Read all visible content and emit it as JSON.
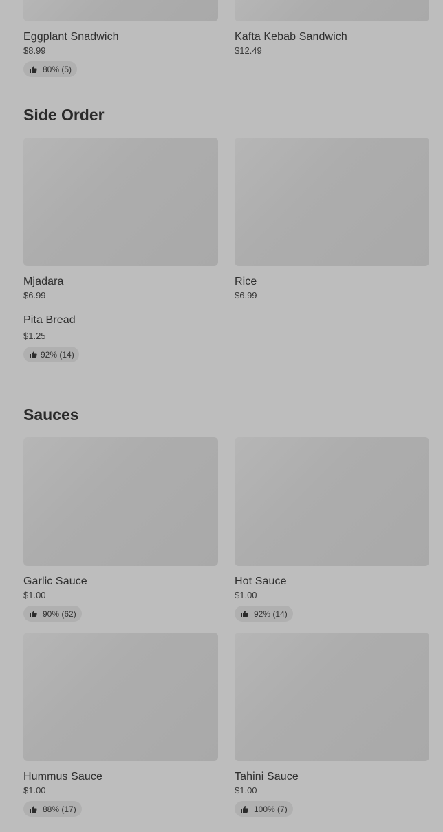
{
  "top_items": [
    {
      "name": "Eggplant Snadwich",
      "price": "$8.99",
      "rating": "80% (5)"
    },
    {
      "name": "Kafta Kebab Sandwich",
      "price": "$12.49",
      "rating": ""
    }
  ],
  "side_order": {
    "title": "Side Order",
    "items": [
      {
        "name": "Mjadara",
        "price": "$6.99"
      },
      {
        "name": "Rice",
        "price": "$6.99"
      },
      {
        "name": "Pita Bread",
        "price": "$1.25",
        "rating": "92% (14)"
      }
    ]
  },
  "sauces": {
    "title": "Sauces",
    "items": [
      {
        "name": "Garlic Sauce",
        "price": "$1.00",
        "rating": "90% (62)"
      },
      {
        "name": "Hot Sauce",
        "price": "$1.00",
        "rating": "92% (14)"
      },
      {
        "name": "Hummus Sauce",
        "price": "$1.00",
        "rating": "88% (17)"
      },
      {
        "name": "Tahini Sauce",
        "price": "$1.00",
        "rating": "100% (7)"
      }
    ]
  },
  "icons": {
    "rating": "thumbs-up-icon"
  },
  "colors": {
    "background": "#bdbdbd",
    "image_placeholder": "#aeaeae",
    "rating_pill": "#b0b0b0"
  }
}
